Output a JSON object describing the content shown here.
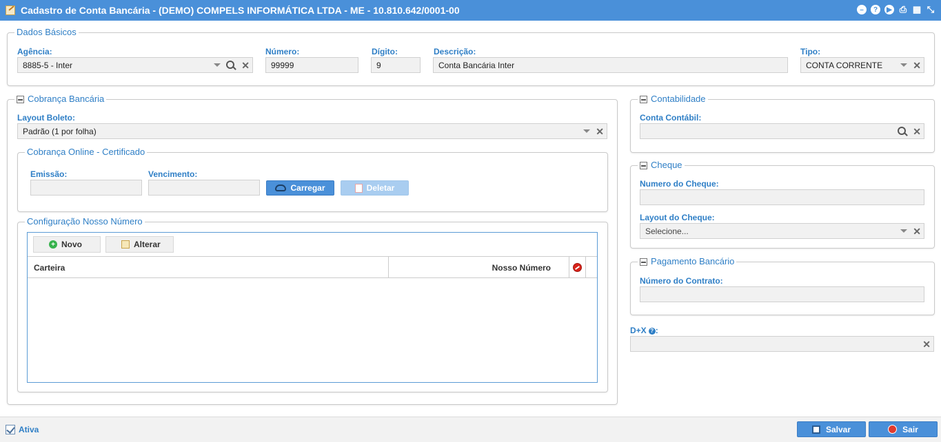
{
  "window": {
    "title": "Cadastro de Conta Bancária - (DEMO) COMPELS INFORMÁTICA LTDA - ME - 10.810.642/0001-00",
    "icon": "edit-icon",
    "controls": [
      "minimize-icon",
      "help-icon",
      "play-icon",
      "print-icon",
      "calendar-icon",
      "fullscreen-icon"
    ]
  },
  "dados_basicos": {
    "legend": "Dados Básicos",
    "agencia": {
      "label": "Agência:",
      "value": "8885-5 - Inter"
    },
    "numero": {
      "label": "Número:",
      "value": "99999"
    },
    "digito": {
      "label": "Dígito:",
      "value": "9"
    },
    "descricao": {
      "label": "Descrição:",
      "value": "Conta Bancária Inter"
    },
    "tipo": {
      "label": "Tipo:",
      "value": "CONTA CORRENTE"
    }
  },
  "cobranca": {
    "legend": "Cobrança Bancária",
    "layout_boleto": {
      "label": "Layout Boleto:",
      "value": "Padrão (1 por folha)"
    },
    "online": {
      "legend": "Cobrança Online - Certificado",
      "emissao": {
        "label": "Emissão:",
        "value": ""
      },
      "vencimento": {
        "label": "Vencimento:",
        "value": ""
      },
      "carregar_label": "Carregar",
      "deletar_label": "Deletar"
    },
    "nosso_numero": {
      "legend": "Configuração Nosso Número",
      "novo_label": "Novo",
      "alterar_label": "Alterar",
      "columns": [
        "Carteira",
        "Nosso Número"
      ],
      "rows": []
    }
  },
  "contabilidade": {
    "legend": "Contabilidade",
    "conta_contabil": {
      "label": "Conta Contábil:",
      "value": ""
    }
  },
  "cheque": {
    "legend": "Cheque",
    "numero": {
      "label": "Numero do Cheque:",
      "value": ""
    },
    "layout": {
      "label": "Layout do Cheque:",
      "value": "Selecione..."
    }
  },
  "pagamento": {
    "legend": "Pagamento Bancário",
    "contrato": {
      "label": "Número do Contrato:",
      "value": ""
    }
  },
  "dx": {
    "label": "D+X",
    "suffix": ":",
    "value": ""
  },
  "footer": {
    "ativa_label": "Ativa",
    "ativa_checked": true,
    "salvar_label": "Salvar",
    "sair_label": "Sair"
  },
  "colors": {
    "accent": "#4a90d9",
    "label": "#2f7fc6"
  }
}
